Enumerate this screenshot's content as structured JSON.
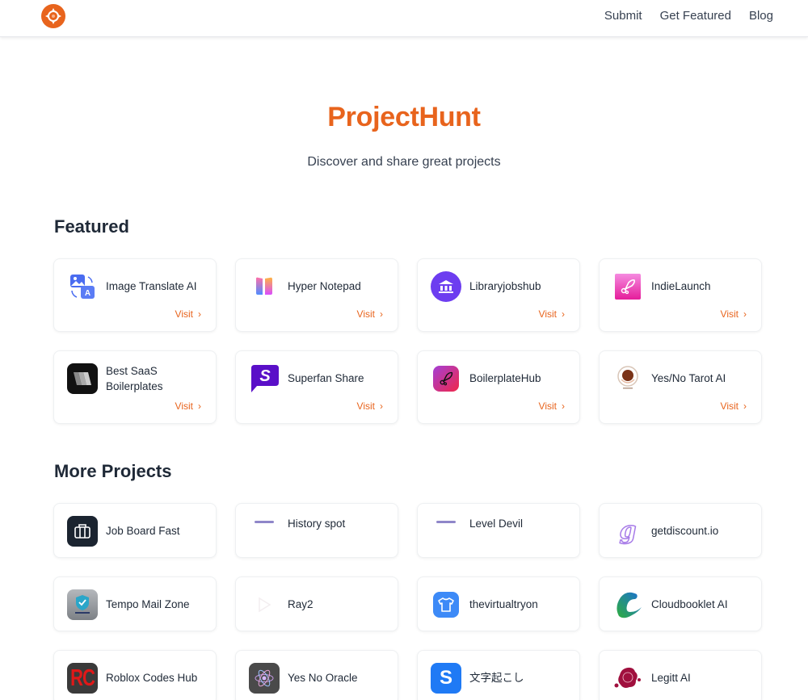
{
  "header": {
    "logo_icon": "crosshair-target-logo",
    "nav": [
      {
        "label": "Submit"
      },
      {
        "label": "Get Featured"
      },
      {
        "label": "Blog"
      }
    ]
  },
  "hero": {
    "title": "ProjectHunt",
    "subtitle": "Discover and share great projects"
  },
  "colors": {
    "brand": "#e8641d",
    "text": "#1f2937",
    "muted": "#374151"
  },
  "featured": {
    "title": "Featured",
    "visit_label": "Visit",
    "items": [
      {
        "name": "Image Translate AI",
        "icon": "image-translate-icon"
      },
      {
        "name": "Hyper Notepad",
        "icon": "hyper-notepad-icon"
      },
      {
        "name": "Libraryjobshub",
        "icon": "library-building-icon"
      },
      {
        "name": "IndieLaunch",
        "icon": "rocket-icon"
      },
      {
        "name": "Best SaaS Boilerplates",
        "icon": "stacked-pages-icon"
      },
      {
        "name": "Superfan Share",
        "icon": "chat-s-icon"
      },
      {
        "name": "BoilerplateHub",
        "icon": "rocket-gradient-icon"
      },
      {
        "name": "Yes/No Tarot AI",
        "icon": "tarot-ball-icon"
      }
    ]
  },
  "more": {
    "title": "More Projects",
    "items": [
      {
        "name": "Job Board Fast",
        "icon": "briefcase-icon"
      },
      {
        "name": "History spot",
        "icon": "history-spot-logo"
      },
      {
        "name": "Level Devil",
        "icon": "level-devil-logo"
      },
      {
        "name": "getdiscount.io",
        "icon": "g-letter-icon"
      },
      {
        "name": "Tempo Mail Zone",
        "icon": "shield-mail-icon"
      },
      {
        "name": "Ray2",
        "icon": "play-icon"
      },
      {
        "name": "thevirtualtryon",
        "icon": "tshirt-icon"
      },
      {
        "name": "Cloudbooklet AI",
        "icon": "c-swoosh-icon"
      },
      {
        "name": "Roblox Codes Hub",
        "icon": "rc-letters-icon"
      },
      {
        "name": "Yes No Oracle",
        "icon": "atom-icon"
      },
      {
        "name": "文字起こし",
        "icon": "s-letter-icon"
      },
      {
        "name": "Legitt AI",
        "icon": "wax-seal-icon"
      }
    ]
  }
}
